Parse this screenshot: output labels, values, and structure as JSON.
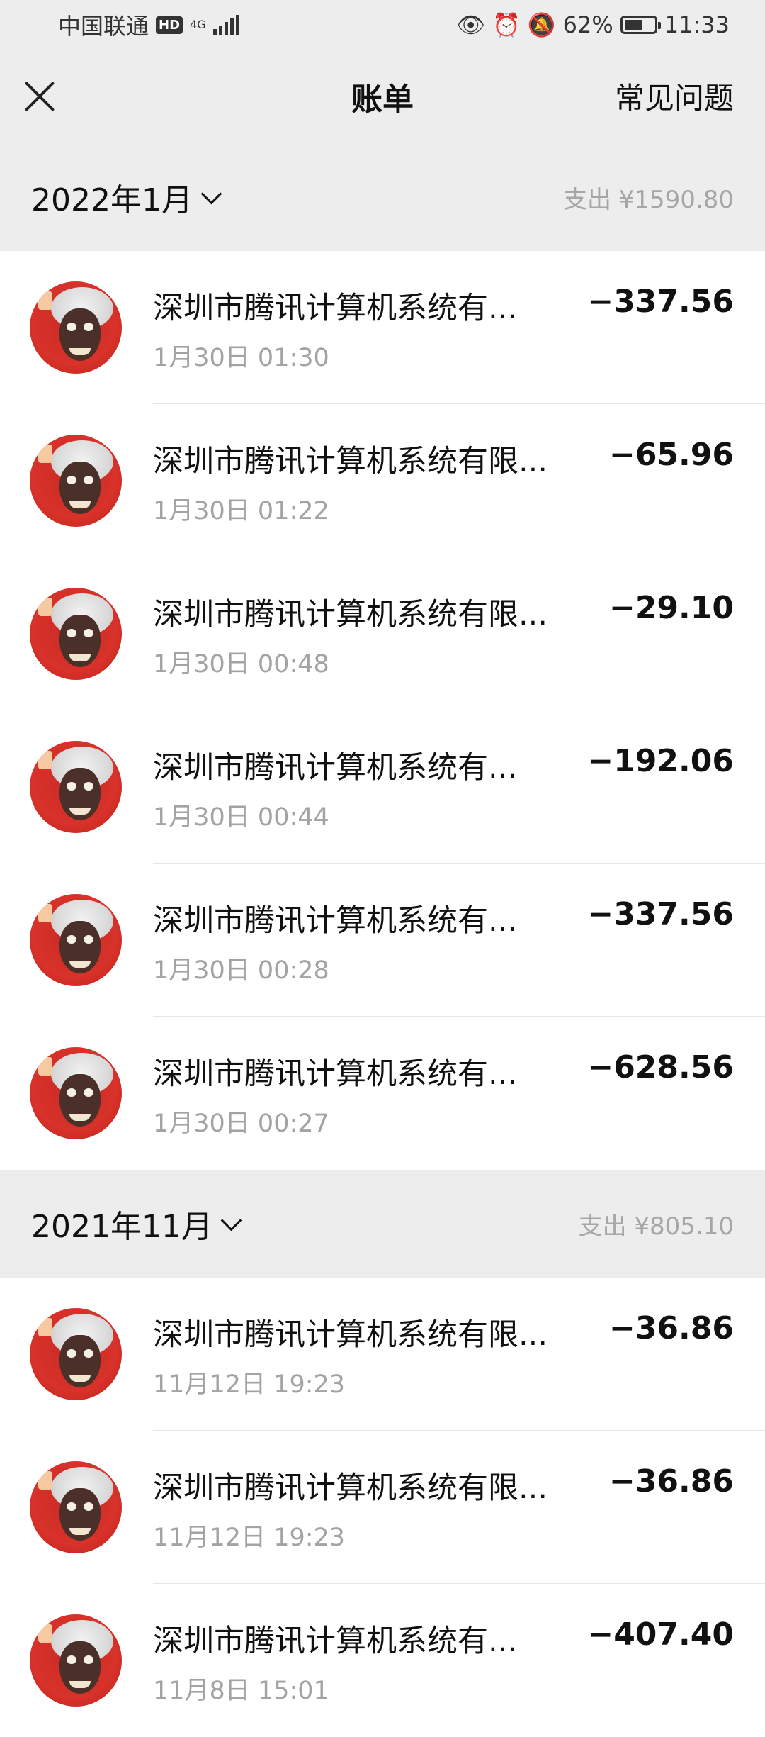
{
  "status_bar": {
    "carrier": "中国联通",
    "hd": "HD",
    "network": "4G",
    "battery": "62%",
    "battery_level": 0.62,
    "time": "11:33"
  },
  "header": {
    "title": "账单",
    "faq": "常见问题"
  },
  "months": [
    {
      "label": "2022年1月",
      "summary": "支出 ¥1590.80",
      "items": [
        {
          "merchant": "深圳市腾讯计算机系统有...",
          "time": "1月30日 01:30",
          "amount": "−337.56"
        },
        {
          "merchant": "深圳市腾讯计算机系统有限...",
          "time": "1月30日 01:22",
          "amount": "−65.96"
        },
        {
          "merchant": "深圳市腾讯计算机系统有限...",
          "time": "1月30日 00:48",
          "amount": "−29.10"
        },
        {
          "merchant": "深圳市腾讯计算机系统有...",
          "time": "1月30日 00:44",
          "amount": "−192.06"
        },
        {
          "merchant": "深圳市腾讯计算机系统有...",
          "time": "1月30日 00:28",
          "amount": "−337.56"
        },
        {
          "merchant": "深圳市腾讯计算机系统有...",
          "time": "1月30日 00:27",
          "amount": "−628.56"
        }
      ]
    },
    {
      "label": "2021年11月",
      "summary": "支出 ¥805.10",
      "items": [
        {
          "merchant": "深圳市腾讯计算机系统有限...",
          "time": "11月12日 19:23",
          "amount": "−36.86"
        },
        {
          "merchant": "深圳市腾讯计算机系统有限...",
          "time": "11月12日 19:23",
          "amount": "−36.86"
        },
        {
          "merchant": "深圳市腾讯计算机系统有...",
          "time": "11月8日 15:01",
          "amount": "−407.40"
        }
      ]
    }
  ]
}
